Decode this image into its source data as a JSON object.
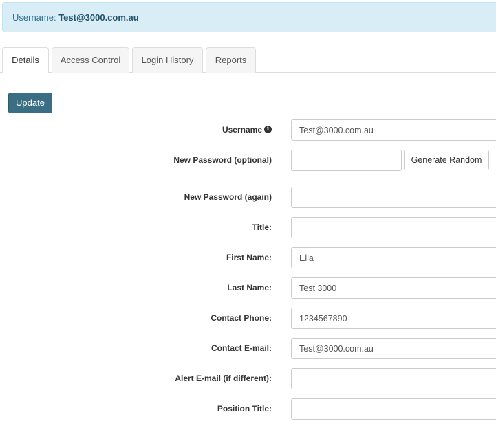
{
  "banner": {
    "prefix": "Username: ",
    "username": "Test@3000.com.au"
  },
  "tabs": [
    {
      "label": "Details",
      "active": true
    },
    {
      "label": "Access Control",
      "active": false
    },
    {
      "label": "Login History",
      "active": false
    },
    {
      "label": "Reports",
      "active": false
    }
  ],
  "actions": {
    "update_label": "Update",
    "generate_label": "Generate Random"
  },
  "form": {
    "username": {
      "label": "Username",
      "value": "Test@3000.com.au",
      "icon": "info-circle-icon"
    },
    "new_password": {
      "label": "New Password (optional)",
      "value": ""
    },
    "new_password_again": {
      "label": "New Password (again)",
      "value": ""
    },
    "title": {
      "label": "Title:",
      "value": ""
    },
    "first_name": {
      "label": "First Name:",
      "value": "Ella"
    },
    "last_name": {
      "label": "Last Name:",
      "value": "Test 3000"
    },
    "contact_phone": {
      "label": "Contact Phone:",
      "value": "1234567890"
    },
    "contact_email": {
      "label": "Contact E-mail:",
      "value": "Test@3000.com.au"
    },
    "alert_email": {
      "label": "Alert E-mail (if different):",
      "value": ""
    },
    "position_title": {
      "label": "Position Title:",
      "value": ""
    }
  },
  "colors": {
    "banner_bg": "#d9edf7",
    "banner_text": "#31708f",
    "primary_button": "#3a6e84"
  }
}
